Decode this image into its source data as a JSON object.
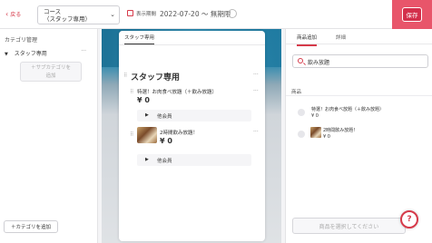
{
  "header": {
    "back_label": "戻る",
    "course_line1": "コース",
    "course_line2": "（スタッフ専用）",
    "period_label": "表示期間",
    "period_value": "2022-07-20 〜 無期限",
    "save_label": "保存"
  },
  "sidebar": {
    "title": "カテゴリ管理",
    "category": "スタッフ専用",
    "more": "···",
    "add_sub_line1": "＋サブカテゴリを",
    "add_sub_line2": "追加",
    "add_category": "＋カテゴリを追加"
  },
  "preview": {
    "tab": "スタッフ専用",
    "section_title": "スタッフ専用",
    "items": [
      {
        "name": "特選！お肉食べ放題（＋飲み放題）",
        "price": "¥ 0",
        "option": "他会員"
      },
      {
        "name": "2時間飲み放題！",
        "price": "¥ 0",
        "option": "他会員"
      }
    ]
  },
  "right": {
    "tabs": [
      "商品追加",
      "詳細"
    ],
    "search_value": "飲み放題",
    "products_title": "商品",
    "products": [
      {
        "name": "特選！お肉食べ放題（＋飲み放題）",
        "price": "¥ 0"
      },
      {
        "name": "2時間飲み放題！",
        "price": "¥ 0"
      }
    ],
    "select_button": "商品を選択してください"
  },
  "help_label": "?",
  "colors": {
    "accent": "#d32f4b",
    "highlight": "#e8556a"
  }
}
